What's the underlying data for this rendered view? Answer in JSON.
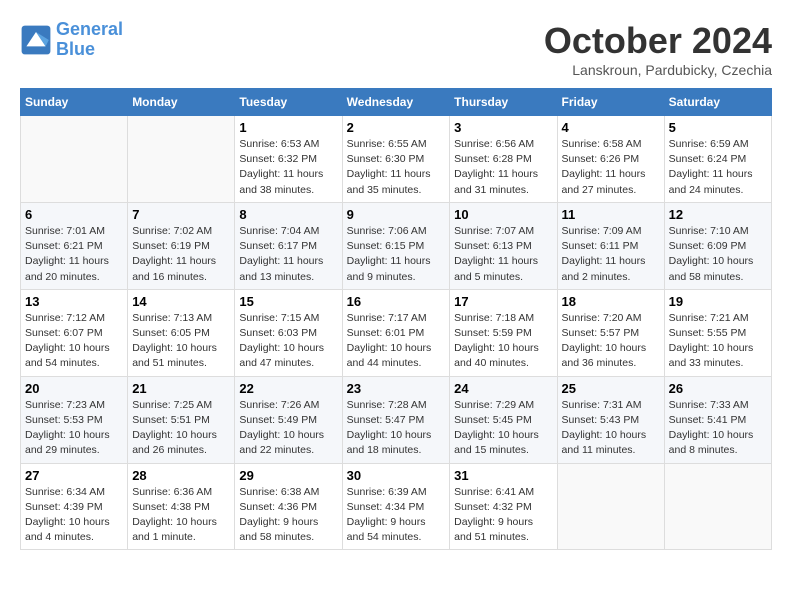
{
  "logo": {
    "line1": "General",
    "line2": "Blue"
  },
  "title": "October 2024",
  "location": "Lanskroun, Pardubicky, Czechia",
  "header": {
    "days": [
      "Sunday",
      "Monday",
      "Tuesday",
      "Wednesday",
      "Thursday",
      "Friday",
      "Saturday"
    ]
  },
  "weeks": [
    [
      {
        "day": "",
        "info": ""
      },
      {
        "day": "",
        "info": ""
      },
      {
        "day": "1",
        "info": "Sunrise: 6:53 AM\nSunset: 6:32 PM\nDaylight: 11 hours and 38 minutes."
      },
      {
        "day": "2",
        "info": "Sunrise: 6:55 AM\nSunset: 6:30 PM\nDaylight: 11 hours and 35 minutes."
      },
      {
        "day": "3",
        "info": "Sunrise: 6:56 AM\nSunset: 6:28 PM\nDaylight: 11 hours and 31 minutes."
      },
      {
        "day": "4",
        "info": "Sunrise: 6:58 AM\nSunset: 6:26 PM\nDaylight: 11 hours and 27 minutes."
      },
      {
        "day": "5",
        "info": "Sunrise: 6:59 AM\nSunset: 6:24 PM\nDaylight: 11 hours and 24 minutes."
      }
    ],
    [
      {
        "day": "6",
        "info": "Sunrise: 7:01 AM\nSunset: 6:21 PM\nDaylight: 11 hours and 20 minutes."
      },
      {
        "day": "7",
        "info": "Sunrise: 7:02 AM\nSunset: 6:19 PM\nDaylight: 11 hours and 16 minutes."
      },
      {
        "day": "8",
        "info": "Sunrise: 7:04 AM\nSunset: 6:17 PM\nDaylight: 11 hours and 13 minutes."
      },
      {
        "day": "9",
        "info": "Sunrise: 7:06 AM\nSunset: 6:15 PM\nDaylight: 11 hours and 9 minutes."
      },
      {
        "day": "10",
        "info": "Sunrise: 7:07 AM\nSunset: 6:13 PM\nDaylight: 11 hours and 5 minutes."
      },
      {
        "day": "11",
        "info": "Sunrise: 7:09 AM\nSunset: 6:11 PM\nDaylight: 11 hours and 2 minutes."
      },
      {
        "day": "12",
        "info": "Sunrise: 7:10 AM\nSunset: 6:09 PM\nDaylight: 10 hours and 58 minutes."
      }
    ],
    [
      {
        "day": "13",
        "info": "Sunrise: 7:12 AM\nSunset: 6:07 PM\nDaylight: 10 hours and 54 minutes."
      },
      {
        "day": "14",
        "info": "Sunrise: 7:13 AM\nSunset: 6:05 PM\nDaylight: 10 hours and 51 minutes."
      },
      {
        "day": "15",
        "info": "Sunrise: 7:15 AM\nSunset: 6:03 PM\nDaylight: 10 hours and 47 minutes."
      },
      {
        "day": "16",
        "info": "Sunrise: 7:17 AM\nSunset: 6:01 PM\nDaylight: 10 hours and 44 minutes."
      },
      {
        "day": "17",
        "info": "Sunrise: 7:18 AM\nSunset: 5:59 PM\nDaylight: 10 hours and 40 minutes."
      },
      {
        "day": "18",
        "info": "Sunrise: 7:20 AM\nSunset: 5:57 PM\nDaylight: 10 hours and 36 minutes."
      },
      {
        "day": "19",
        "info": "Sunrise: 7:21 AM\nSunset: 5:55 PM\nDaylight: 10 hours and 33 minutes."
      }
    ],
    [
      {
        "day": "20",
        "info": "Sunrise: 7:23 AM\nSunset: 5:53 PM\nDaylight: 10 hours and 29 minutes."
      },
      {
        "day": "21",
        "info": "Sunrise: 7:25 AM\nSunset: 5:51 PM\nDaylight: 10 hours and 26 minutes."
      },
      {
        "day": "22",
        "info": "Sunrise: 7:26 AM\nSunset: 5:49 PM\nDaylight: 10 hours and 22 minutes."
      },
      {
        "day": "23",
        "info": "Sunrise: 7:28 AM\nSunset: 5:47 PM\nDaylight: 10 hours and 18 minutes."
      },
      {
        "day": "24",
        "info": "Sunrise: 7:29 AM\nSunset: 5:45 PM\nDaylight: 10 hours and 15 minutes."
      },
      {
        "day": "25",
        "info": "Sunrise: 7:31 AM\nSunset: 5:43 PM\nDaylight: 10 hours and 11 minutes."
      },
      {
        "day": "26",
        "info": "Sunrise: 7:33 AM\nSunset: 5:41 PM\nDaylight: 10 hours and 8 minutes."
      }
    ],
    [
      {
        "day": "27",
        "info": "Sunrise: 6:34 AM\nSunset: 4:39 PM\nDaylight: 10 hours and 4 minutes."
      },
      {
        "day": "28",
        "info": "Sunrise: 6:36 AM\nSunset: 4:38 PM\nDaylight: 10 hours and 1 minute."
      },
      {
        "day": "29",
        "info": "Sunrise: 6:38 AM\nSunset: 4:36 PM\nDaylight: 9 hours and 58 minutes."
      },
      {
        "day": "30",
        "info": "Sunrise: 6:39 AM\nSunset: 4:34 PM\nDaylight: 9 hours and 54 minutes."
      },
      {
        "day": "31",
        "info": "Sunrise: 6:41 AM\nSunset: 4:32 PM\nDaylight: 9 hours and 51 minutes."
      },
      {
        "day": "",
        "info": ""
      },
      {
        "day": "",
        "info": ""
      }
    ]
  ]
}
